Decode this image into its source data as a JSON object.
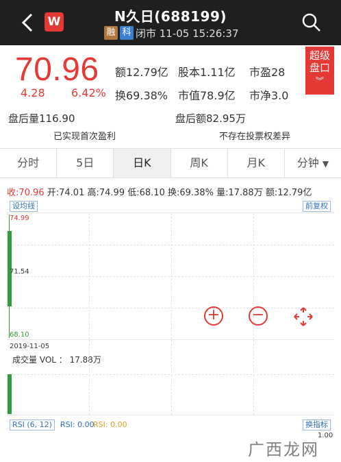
{
  "header": {
    "title": "N久日(688199)",
    "logo_label": "W",
    "tag_rong": "融",
    "tag_ke": "科",
    "status": "闭市 11-05 15:26:37"
  },
  "quote": {
    "price": "70.96",
    "change": "4.28",
    "change_pct": "6.42%",
    "turnover_amount": "额12.79亿",
    "share_capital": "股本1.11亿",
    "pe": "市盈28",
    "turnover_rate": "换69.38%",
    "market_cap": "市值78.9亿",
    "pb": "市净3.0",
    "badge": [
      "超级",
      "盘口"
    ],
    "after_volume": "盘后量116.90",
    "after_amount": "盘后额82.95万",
    "note_left": "已实现首次盈利",
    "note_right": "不存在投票权差异"
  },
  "tabs": [
    "分时",
    "5日",
    "日K",
    "周K",
    "月K",
    "分钟"
  ],
  "kline": {
    "close": "收:70.96",
    "open": "开:74.01",
    "high": "高:74.99",
    "low": "低:68.10",
    "turnover": "换:69.38%",
    "volume": "量:17.88万",
    "amount": "额:12.79亿",
    "ma_button": "设均线",
    "adjust_button": "前复权",
    "y_max": "74.99",
    "y_mid": "71.54",
    "y_min": "68.10",
    "date": "2019-11-05",
    "vol_label": "成交量 VOL ： 17.88万",
    "rsi_param": "RSI (6, 12)",
    "rsi1": "RSI: 0.00",
    "rsi2": "RSI: 0.00",
    "switch_button": "换指标",
    "rsi_axis": "1.00"
  },
  "watermark": "广西龙网",
  "colors": {
    "up": "#e53935",
    "down": "#2e9e3a",
    "header": "#1f1f1f"
  }
}
